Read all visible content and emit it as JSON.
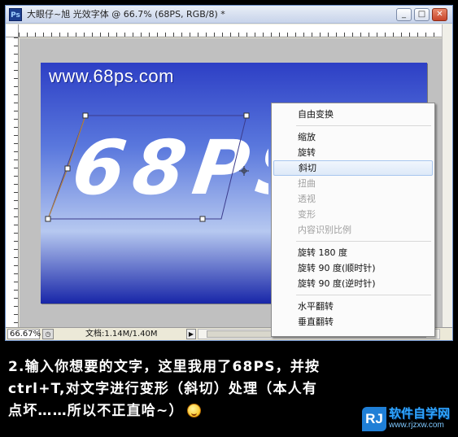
{
  "window": {
    "app_icon": "Ps",
    "title": "大眼仔~旭 光效字体 @ 66.7% (68PS, RGB/8) *",
    "minimize": "_",
    "maximize": "□",
    "close": "✕"
  },
  "canvas": {
    "watermark": "www.68ps.com",
    "big_text": "68PS"
  },
  "context_menu": {
    "items": [
      {
        "label": "自由变换",
        "disabled": false
      },
      {
        "label": "缩放",
        "disabled": false
      },
      {
        "label": "旋转",
        "disabled": false
      },
      {
        "label": "斜切",
        "disabled": false,
        "highlighted": true
      },
      {
        "label": "扭曲",
        "disabled": true
      },
      {
        "label": "透视",
        "disabled": true
      },
      {
        "label": "变形",
        "disabled": true
      },
      {
        "label": "内容识别比例",
        "disabled": true
      },
      {
        "label": "旋转 180 度",
        "disabled": false
      },
      {
        "label": "旋转 90 度(顺时针)",
        "disabled": false
      },
      {
        "label": "旋转 90 度(逆时针)",
        "disabled": false
      },
      {
        "label": "水平翻转",
        "disabled": false
      },
      {
        "label": "垂直翻转",
        "disabled": false
      }
    ]
  },
  "status": {
    "zoom": "66.67%",
    "doc_info": "文档:1.14M/1.40M",
    "arrow": "▶"
  },
  "caption": {
    "line1": "2.输入你想要的文字，这里我用了68PS，并按",
    "line2": "ctrl+T,对文字进行变形（斜切）处理（本人有",
    "line3": "点坏……所以不正直哈~）"
  },
  "site_logo": {
    "mark": "RJ",
    "name": "软件自学网",
    "url": "www.rjzxw.com"
  },
  "colors": {
    "canvas_blue": "#2d3fc5",
    "menu_highlight": "#dde9f8",
    "logo_blue": "#1f7fd6"
  }
}
